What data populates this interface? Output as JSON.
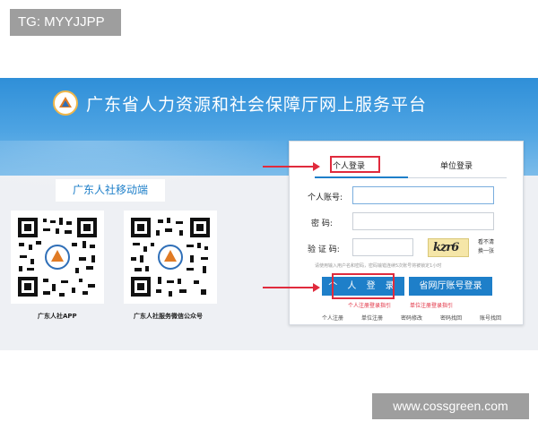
{
  "overlay": {
    "tg_label": "TG: MYYJJPP",
    "watermark": "www.cossgreen.com"
  },
  "header": {
    "title": "广东省人力资源和社会保障厅网上服务平台",
    "logo_icon": "hrss-emblem-icon"
  },
  "mobile": {
    "heading": "广东人社移动端",
    "qr_codes": [
      {
        "caption": "广东人社APP"
      },
      {
        "caption": "广东人社服务微信公众号"
      }
    ]
  },
  "login": {
    "tabs": [
      {
        "label": "个人登录",
        "active": true
      },
      {
        "label": "单位登录",
        "active": false
      }
    ],
    "fields": {
      "account_label": "个人账号:",
      "password_label": "密    码:",
      "captcha_label": "验 证 码:",
      "account_value": "",
      "password_value": "",
      "captcha_value": ""
    },
    "captcha": {
      "text": "kzr6",
      "refresh_line1": "看不清",
      "refresh_line2": "换一张"
    },
    "hint": "请使用输入用户名和密码，密码输错连续5次账号将被锁定1小时",
    "buttons": {
      "personal_login": "个 人 登 录",
      "gov_account_login": "省网厅账号登录"
    },
    "guides": {
      "personal": "个人注册登录指引",
      "unit": "单位注册登录指引"
    },
    "footer_links": [
      "个人注册",
      "单位注册",
      "密码修改",
      "密码找回",
      "账号找回"
    ]
  },
  "colors": {
    "accent": "#1e7fc9",
    "banner": "#2f8fd8",
    "highlight": "#e02b3d"
  }
}
